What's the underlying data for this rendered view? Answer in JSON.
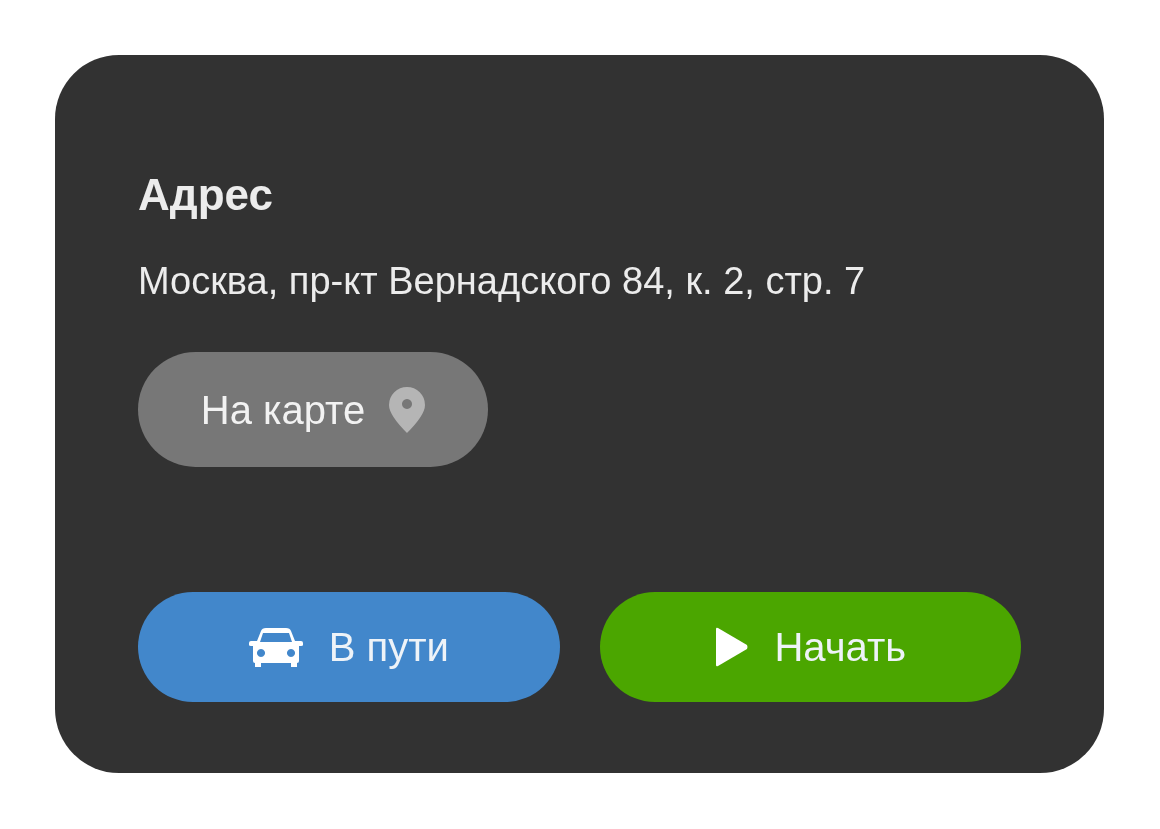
{
  "card": {
    "title": "Адрес",
    "address": "Москва, пр-кт Вернадского 84, к. 2, стр. 7",
    "map_button": {
      "label": "На карте"
    },
    "actions": [
      {
        "kind": "enroute",
        "label": "В пути"
      },
      {
        "kind": "start",
        "label": "Начать"
      }
    ]
  }
}
